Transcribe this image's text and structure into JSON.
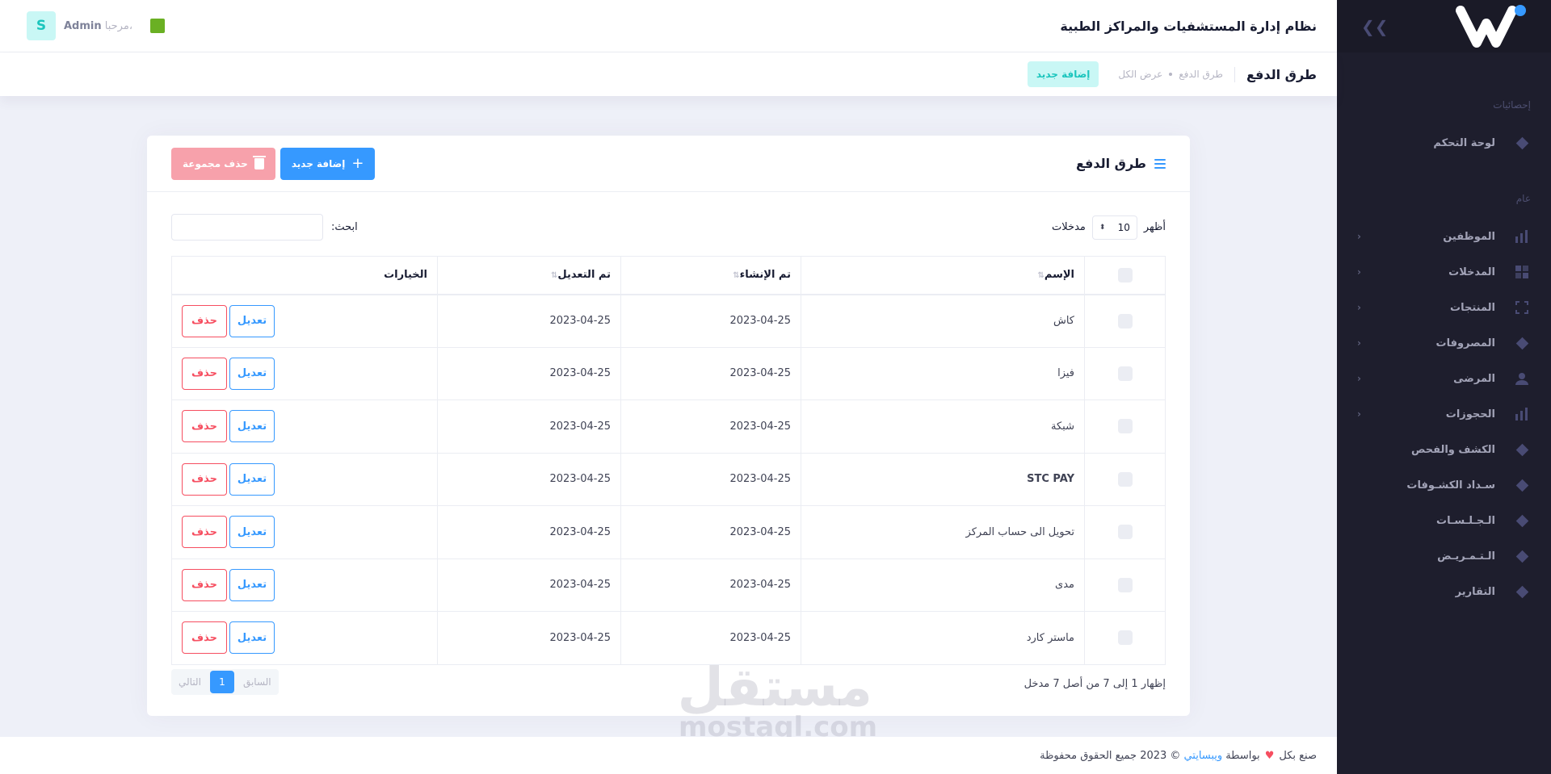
{
  "header": {
    "title": "نظام إدارة المستشفيات والمراكز الطبية",
    "greeting": "مرحبا،",
    "user_name": "Admin",
    "avatar_letter": "S"
  },
  "subheader": {
    "title": "طرق الدفع",
    "crumb1": "طرق الدفع",
    "crumb2": "عرض الكل",
    "add_label": "إضافة جديد"
  },
  "sidebar": {
    "section_stats": "إحصائيات",
    "section_general": "عام",
    "items": [
      {
        "label": "لوحة التحكم",
        "icon": "diamond-icon",
        "arrow": false
      },
      {
        "label": "الموظفين",
        "icon": "chart-icon",
        "arrow": true
      },
      {
        "label": "المدخلات",
        "icon": "grid-icon",
        "arrow": true
      },
      {
        "label": "المنتجات",
        "icon": "expand-icon",
        "arrow": true
      },
      {
        "label": "المصروفات",
        "icon": "diamond-icon",
        "arrow": true
      },
      {
        "label": "المرضى",
        "icon": "user-icon",
        "arrow": true
      },
      {
        "label": "الحجوزات",
        "icon": "chart-icon",
        "arrow": true
      },
      {
        "label": "الكشف والفحص",
        "icon": "diamond-icon",
        "arrow": false
      },
      {
        "label": "سـداد الكشـوفات",
        "icon": "diamond-icon",
        "arrow": false
      },
      {
        "label": "الـجـلـسـات",
        "icon": "diamond-icon",
        "arrow": false
      },
      {
        "label": "الـتـمـريـض",
        "icon": "diamond-icon",
        "arrow": false
      },
      {
        "label": "التقارير",
        "icon": "diamond-icon",
        "arrow": false
      }
    ]
  },
  "card": {
    "title": "طرق الدفع",
    "add_button": "إضافة جديد",
    "bulk_delete_button": "حذف مجموعة",
    "show_label": "أظهر",
    "page_size": "10",
    "entries_label": "مدخلات",
    "search_label": "ابحث:",
    "search_value": ""
  },
  "table": {
    "columns": [
      "الإسم",
      "تم الإنشاء",
      "تم التعديل",
      "الخيارات"
    ],
    "edit_label": "تعديل",
    "delete_label": "حذف",
    "rows": [
      {
        "name": "كاش",
        "created": "2023-04-25",
        "updated": "2023-04-25"
      },
      {
        "name": "فيزا",
        "created": "2023-04-25",
        "updated": "2023-04-25"
      },
      {
        "name": "شبكة",
        "created": "2023-04-25",
        "updated": "2023-04-25"
      },
      {
        "name": "STC PAY",
        "created": "2023-04-25",
        "updated": "2023-04-25"
      },
      {
        "name": "تحويل الى حساب المركز",
        "created": "2023-04-25",
        "updated": "2023-04-25"
      },
      {
        "name": "مدى",
        "created": "2023-04-25",
        "updated": "2023-04-25"
      },
      {
        "name": "ماستر كارد",
        "created": "2023-04-25",
        "updated": "2023-04-25"
      }
    ],
    "info": "إظهار 1 إلى 7 من أصل 7 مدخل",
    "pager": {
      "prev": "السابق",
      "current": "1",
      "next": "التالي"
    }
  },
  "watermark": {
    "line1": "مستقل",
    "line2": "mostaql.com"
  },
  "footer": {
    "made_with": "صنع بكل",
    "by": "بواسطة",
    "company": "ويبسايتي",
    "rights": "© 2023 جميع الحقوق محفوظة"
  },
  "colors": {
    "primary": "#3699ff",
    "danger": "#f64e60",
    "sidebar": "#1e1e2d",
    "accent_teal": "#1bc5bd"
  }
}
